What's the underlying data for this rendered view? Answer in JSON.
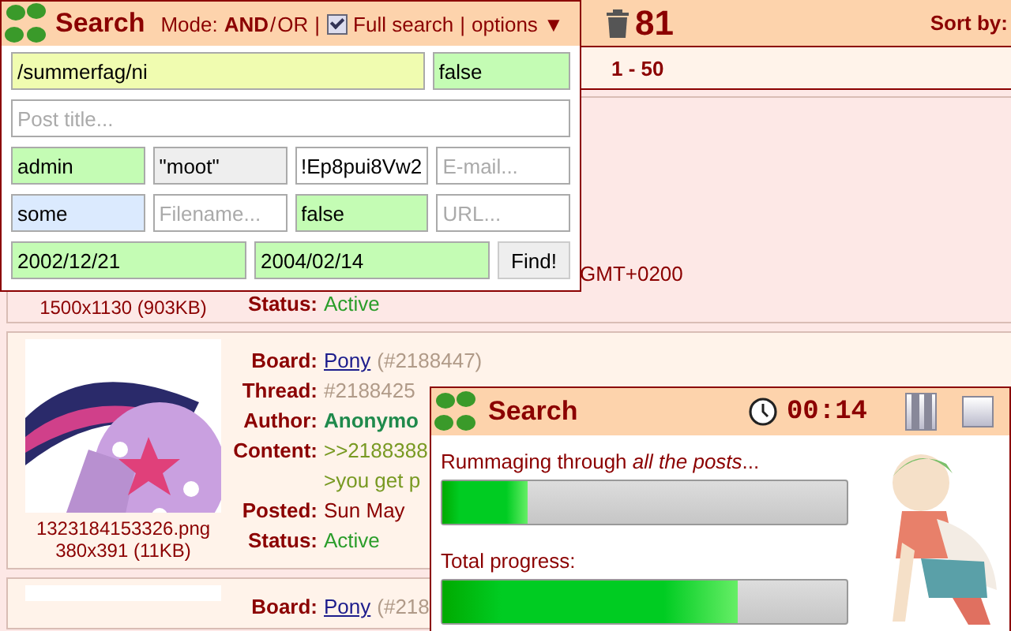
{
  "top_bar": {
    "count": "81",
    "sort_label": "Sort by:"
  },
  "pager": {
    "range": "1 - 50"
  },
  "posts": [
    {
      "kind": "covered",
      "dimensions": "1500x1130 (903KB)",
      "rows": [
        {
          "parts": [
            {
              "text": "GMT+0200",
              "kind": "date"
            }
          ]
        },
        {
          "label": "Status:",
          "parts": [
            {
              "text": "Active",
              "kind": "status"
            }
          ]
        }
      ]
    },
    {
      "kind": "full",
      "thumbnail": {
        "kind": "picture"
      },
      "filename": "1323184153326.png",
      "dimensions": "380x391 (11KB)",
      "rows": [
        {
          "label": "Board:",
          "parts": [
            {
              "text": "Pony",
              "kind": "link"
            },
            {
              "text": "(#2188447)",
              "kind": "muted"
            }
          ]
        },
        {
          "label": "Thread:",
          "parts": [
            {
              "text": "#2188425",
              "kind": "muted"
            }
          ]
        },
        {
          "label": "Author:",
          "parts": [
            {
              "text": "Anonymo",
              "kind": "author"
            }
          ]
        },
        {
          "label": "Content:",
          "parts": [
            {
              "text": ">>2188388",
              "kind": "greentext"
            }
          ]
        },
        {
          "parts": [
            {
              "text": ">you get p",
              "kind": "greentext"
            }
          ]
        },
        {
          "label": "Posted:",
          "parts": [
            {
              "text": "Sun May",
              "kind": "date"
            }
          ]
        },
        {
          "label": "Status:",
          "parts": [
            {
              "text": "Active",
              "kind": "status"
            }
          ]
        }
      ]
    },
    {
      "kind": "full",
      "thumbnail": {
        "kind": "picture"
      },
      "rows": [
        {
          "label": "Board:",
          "parts": [
            {
              "text": "Pony",
              "kind": "link"
            },
            {
              "text": "(#218",
              "kind": "muted"
            }
          ]
        }
      ]
    }
  ],
  "search_panel": {
    "title": "Search",
    "mode_label": "Mode:",
    "modes": [
      {
        "label": "AND",
        "selected": true
      },
      {
        "label": "OR",
        "selected": false
      }
    ],
    "mode_separator": "/",
    "divider": "|",
    "full_search": {
      "label": "Full search",
      "checked": true
    },
    "divider_2": "|",
    "options": {
      "label": "options",
      "arrow": "▼"
    },
    "field_rows": [
      [
        {
          "value": "/summerfag/ni",
          "color": "#f0fcb0",
          "wide": true
        },
        {
          "value": "false",
          "color": "#c4fcb4"
        }
      ],
      [
        {
          "placeholder": "Post title...",
          "color": "#ffffff"
        }
      ],
      [
        {
          "value": "admin",
          "color": "#c4fcb4"
        },
        {
          "value": "\"moot\"",
          "color": "#eeeeee"
        },
        {
          "value": "!Ep8pui8Vw2",
          "color": "#ffffff"
        },
        {
          "placeholder": "E-mail...",
          "color": "#ffffff"
        }
      ],
      [
        {
          "value": "some",
          "color": "#dbeafe"
        },
        {
          "placeholder": "Filename...",
          "color": "#ffffff"
        },
        {
          "value": "false",
          "color": "#c4fcb4"
        },
        {
          "placeholder": "URL...",
          "color": "#ffffff"
        }
      ]
    ],
    "date_from": {
      "value": "2002/12/21",
      "color": "#c4fcb4"
    },
    "date_to": {
      "value": "2004/02/14",
      "color": "#c4fcb4"
    },
    "find_button": "Find!"
  },
  "progress_panel": {
    "title": "Search",
    "timer": "00:14",
    "bars": [
      {
        "label": "Rummaging through *all the posts*...",
        "level": 0.21
      },
      {
        "label": "Total progress:",
        "level": 0.73
      }
    ]
  }
}
